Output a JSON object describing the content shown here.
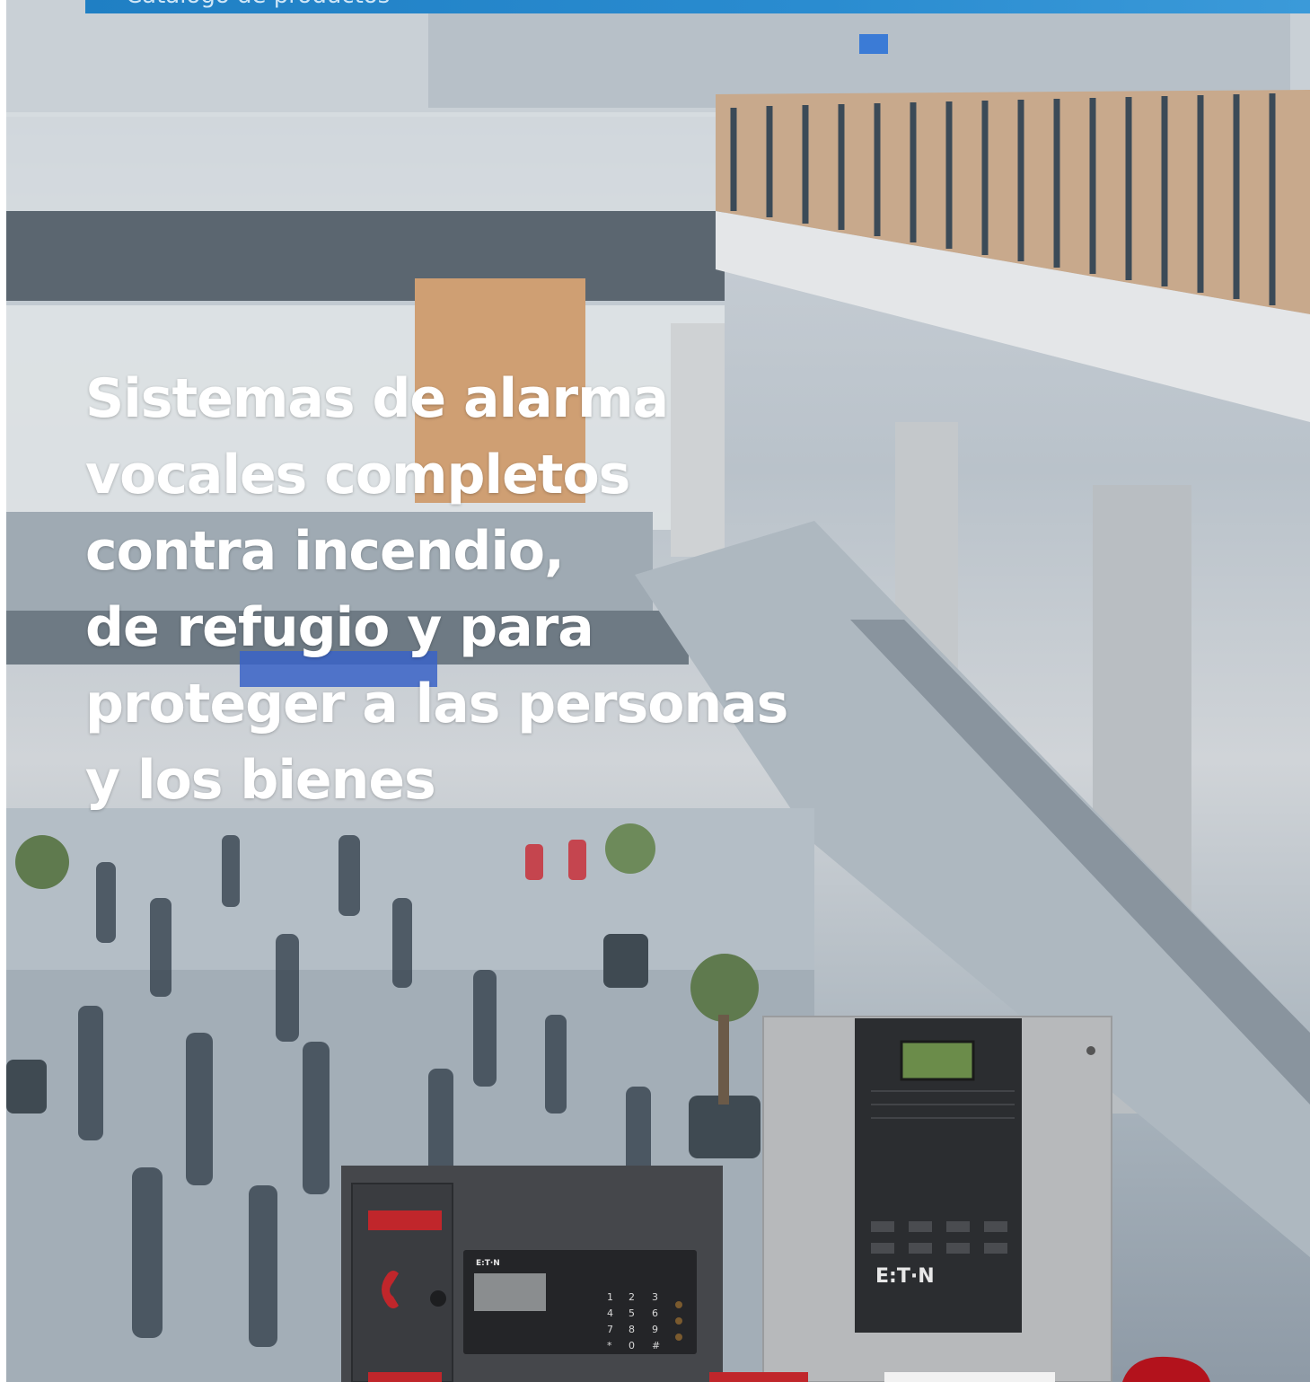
{
  "banner": {
    "text": "Catálogo de productos"
  },
  "headline": {
    "lines": [
      "Sistemas de alarma",
      "vocales completos",
      "contra incendio,",
      "de refugio y para",
      "proteger a las personas",
      "y los bienes"
    ]
  },
  "products": {
    "brand_left": "E:T·N",
    "brand_right": "E:T·N",
    "keypad_keys": [
      "1",
      "2",
      "3",
      "4",
      "5",
      "6",
      "7",
      "8",
      "9",
      "*",
      "0",
      "#"
    ]
  },
  "colors": {
    "banner": "#1f7fc4",
    "headline": "#ffffff",
    "panel_dark": "#2b2d30",
    "panel_grey": "#b7b9bb",
    "alarm_red": "#c0262b"
  },
  "icons": [
    "telephone-icon"
  ]
}
